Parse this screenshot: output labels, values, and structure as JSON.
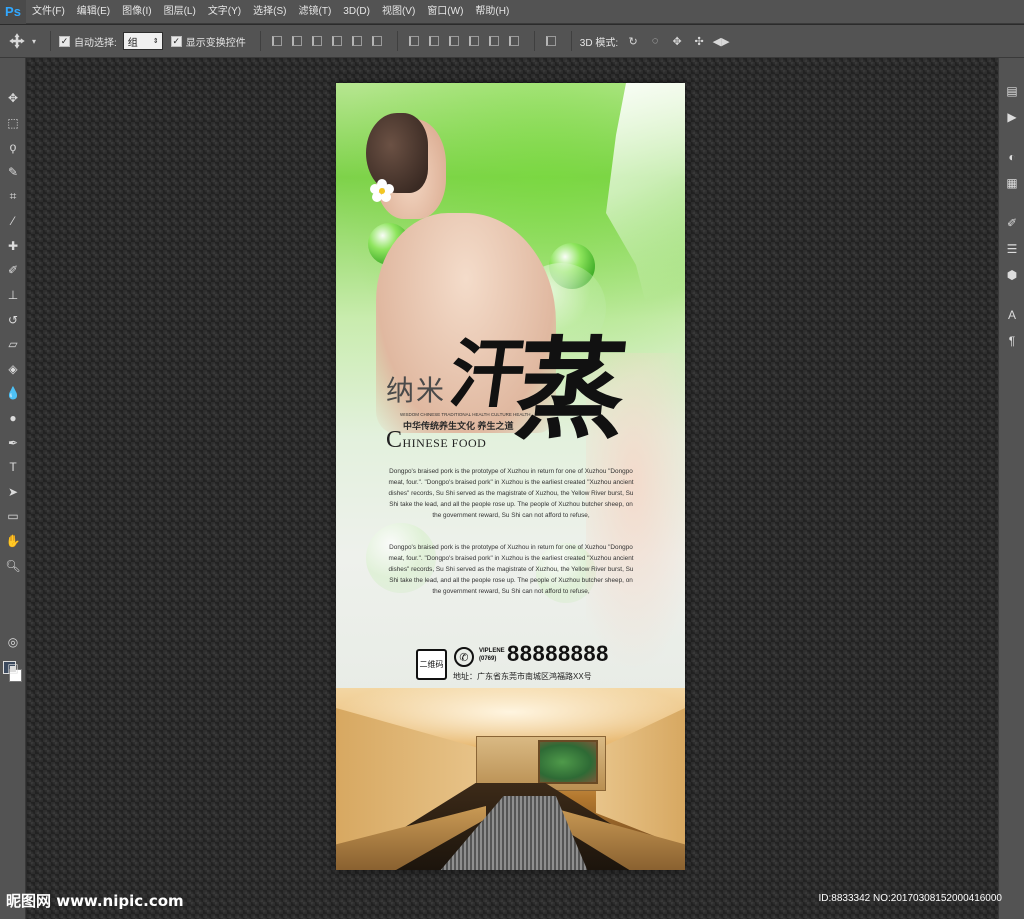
{
  "app": {
    "logo": "Ps",
    "menu": [
      "文件(F)",
      "编辑(E)",
      "图像(I)",
      "图层(L)",
      "文字(Y)",
      "选择(S)",
      "滤镜(T)",
      "3D(D)",
      "视图(V)",
      "窗口(W)",
      "帮助(H)"
    ]
  },
  "options": {
    "auto_select_label": "自动选择:",
    "auto_select_value": "组",
    "show_transform_label": "显示变换控件",
    "mode_3d_label": "3D 模式:"
  },
  "poster": {
    "title_small": "纳米",
    "title_char1": "汗",
    "title_char2": "蒸",
    "tagline": "中华传统养生文化  养生之道",
    "tagline_small": "WISDOM CHINESE TRADITIONAL HEALTH CULTURE HEALTH",
    "chinese_food_initial": "C",
    "chinese_food_rest": "HINESE FOOD",
    "paragraph1": "Dongpo's braised pork is the prototype of Xuzhou in return for one of Xuzhou \"Dongpo meat, four.\". \"Dongpo's braised pork\" in Xuzhou is the earliest created \"Xuzhou ancient dishes\" records, Su Shi served as the magistrate of Xuzhou, the Yellow River burst, Su Shi take the lead, and all the people rose up. The people of Xuzhou butcher sheep, on the government reward, Su Shi can not afford to refuse,",
    "paragraph2": "Dongpo's braised pork is the prototype of Xuzhou in return for one of Xuzhou \"Dongpo meat, four.\". \"Dongpo's braised pork\" in Xuzhou is the earliest created \"Xuzhou ancient dishes\" records, Su Shi served as the magistrate of Xuzhou, the Yellow River burst, Su Shi take the lead, and all the people rose up. The people of Xuzhou butcher sheep, on the government reward, Su Shi can not afford to refuse,",
    "qr_label": "二维码",
    "phone_label1": "VIPLENE",
    "phone_label2": "(0769)",
    "phone_number": "88888888",
    "address": "地址：广东省东莞市南城区鸿福路XX号"
  },
  "watermark": {
    "left": "昵图网 www.nipic.com",
    "right": "ID:8833342 NO:20170308152000416000"
  },
  "colors": {
    "ui_panel": "#535353",
    "ui_dark": "#2b2b2b",
    "ps_blue": "#31a8ff",
    "poster_green": "#7ed24a"
  }
}
